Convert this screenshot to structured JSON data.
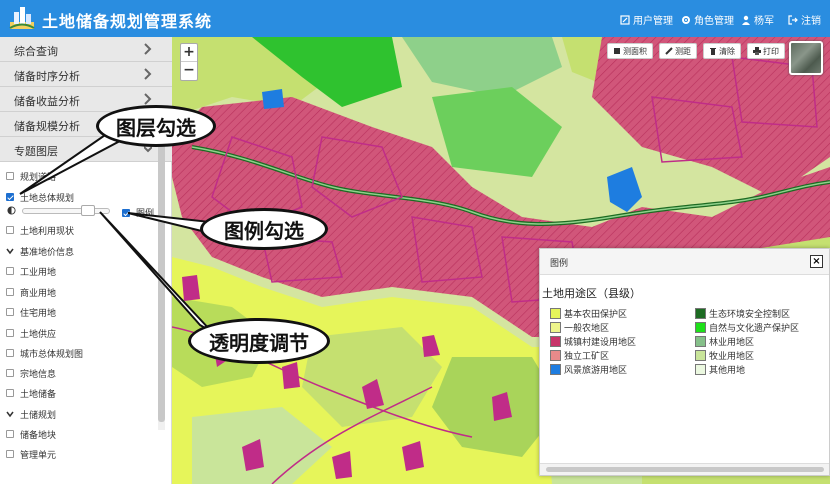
{
  "header": {
    "app_title": "土地储备规划管理系统",
    "nav": [
      {
        "label": "用户管理",
        "icon": "edit-icon"
      },
      {
        "label": "角色管理",
        "icon": "gear-icon"
      },
      {
        "label": "杨军",
        "icon": "user-icon"
      },
      {
        "label": "注销",
        "icon": "logout-icon"
      }
    ]
  },
  "sidebar": {
    "menu": [
      {
        "label": "综合查询"
      },
      {
        "label": "储备时序分析"
      },
      {
        "label": "储备收益分析"
      },
      {
        "label": "储备规模分析"
      },
      {
        "label": "专题图层"
      }
    ],
    "layers": [
      {
        "label": "规划道路",
        "checked": false
      },
      {
        "label": "土地总体规划",
        "checked": true
      },
      {
        "label": "土地利用现状",
        "checked": false
      },
      {
        "label": "基准地价信息",
        "group": true
      },
      {
        "label": "工业用地",
        "checked": false
      },
      {
        "label": "商业用地",
        "checked": false
      },
      {
        "label": "住宅用地",
        "checked": false
      },
      {
        "label": "土地供应",
        "checked": false
      },
      {
        "label": "城市总体规划图",
        "checked": false
      },
      {
        "label": "宗地信息",
        "checked": false
      },
      {
        "label": "土地储备",
        "checked": false
      },
      {
        "label": "土储规划",
        "group": true
      },
      {
        "label": "储备地块",
        "checked": false
      },
      {
        "label": "管理单元",
        "checked": false
      }
    ],
    "opacity": 0.8,
    "legend_toggle_label": "图例",
    "legend_toggle_checked": true
  },
  "map": {
    "zoom_in": "+",
    "zoom_out": "−",
    "toolbar": [
      {
        "label": "测面积",
        "icon": "area-measure-icon"
      },
      {
        "label": "测距",
        "icon": "ruler-icon"
      },
      {
        "label": "清除",
        "icon": "trash-icon"
      },
      {
        "label": "打印",
        "icon": "print-icon"
      }
    ]
  },
  "legend": {
    "title": "图例",
    "close": "×",
    "subtitle": "土地用途区（县级）",
    "items": [
      {
        "label": "基本农田保护区",
        "color": "#e6f55a"
      },
      {
        "label": "生态环境安全控制区",
        "color": "#1d6b23"
      },
      {
        "label": "一般农地区",
        "color": "#eef58c"
      },
      {
        "label": "自然与文化遗产保护区",
        "color": "#1ee01a"
      },
      {
        "label": "城镇村建设用地区",
        "color": "#c8346a"
      },
      {
        "label": "林业用地区",
        "color": "#86c08a"
      },
      {
        "label": "独立工矿区",
        "color": "#e88a8a"
      },
      {
        "label": "牧业用地区",
        "color": "#c9e59a"
      },
      {
        "label": "风景旅游用地区",
        "color": "#1e7de0"
      },
      {
        "label": "其他用地",
        "color": "#ebf8e0"
      }
    ]
  },
  "callouts": {
    "layer_check": "图层勾选",
    "legend_check": "图例勾选",
    "opacity_adjust": "透明度调节"
  }
}
